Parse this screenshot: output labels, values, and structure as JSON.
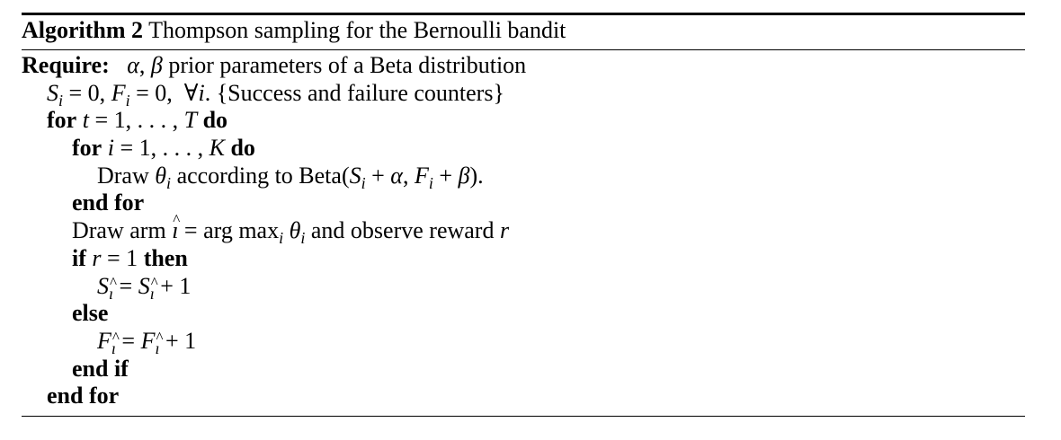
{
  "algorithm": {
    "label": "Algorithm 2",
    "title": "Thompson sampling for the Bernoulli bandit",
    "keywords": {
      "require": "Require:",
      "for": "for",
      "do": "do",
      "end_for": "end for",
      "if": "if",
      "then": "then",
      "else": "else",
      "end_if": "end if"
    },
    "lines": {
      "require_text": " prior parameters of a Beta distribution",
      "init_comment": "{Success and failure counters}",
      "draw_theta_prefix": "Draw ",
      "draw_theta_mid": " according to Beta",
      "draw_arm_prefix": "Draw arm ",
      "draw_arm_suffix": " and observe reward "
    }
  }
}
